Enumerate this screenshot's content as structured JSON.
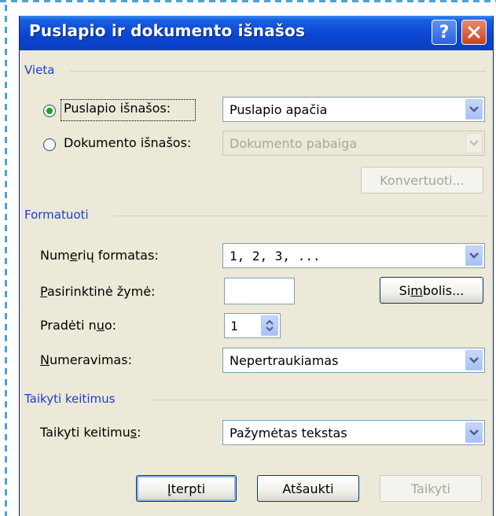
{
  "dialog": {
    "title": "Puslapio ir dokumento išnašos",
    "help_label": "?",
    "close_icon": "close-icon",
    "help_icon": "help-icon"
  },
  "vieta": {
    "group_label": "Vieta",
    "radio_page_label": "Puslapio išnašos:",
    "radio_page_selected": true,
    "radio_doc_label": "Dokumento išnašos:",
    "radio_doc_selected": false,
    "page_combo_value": "Puslapio apačia",
    "doc_combo_value": "Dokumento pabaiga",
    "convert_button": "Konvertuoti..."
  },
  "formatuoti": {
    "group_label": "Formatuoti",
    "number_format_label": "Numerių formatas:",
    "number_format_value": "1, 2, 3, ...",
    "custom_mark_label": "Pasirinktinė žymė:",
    "custom_mark_value": "",
    "symbol_button": "Simbolis...",
    "start_at_label": "Pradėti nuo:",
    "start_at_value": "1",
    "numbering_label": "Numeravimas:",
    "numbering_value": "Nepertraukiamas"
  },
  "taikyti": {
    "group_label": "Taikyti keitimus",
    "apply_changes_label": "Taikyti keitimus:",
    "apply_changes_value": "Pažymėtas tekstas"
  },
  "buttons": {
    "insert": "Įterpti",
    "cancel": "Atšaukti",
    "apply": "Taikyti"
  },
  "colors": {
    "title_bar": "#0a46d2",
    "group_label": "#1e3ccc",
    "dialog_bg": "#ece9d8",
    "close_button": "#c8441c"
  }
}
